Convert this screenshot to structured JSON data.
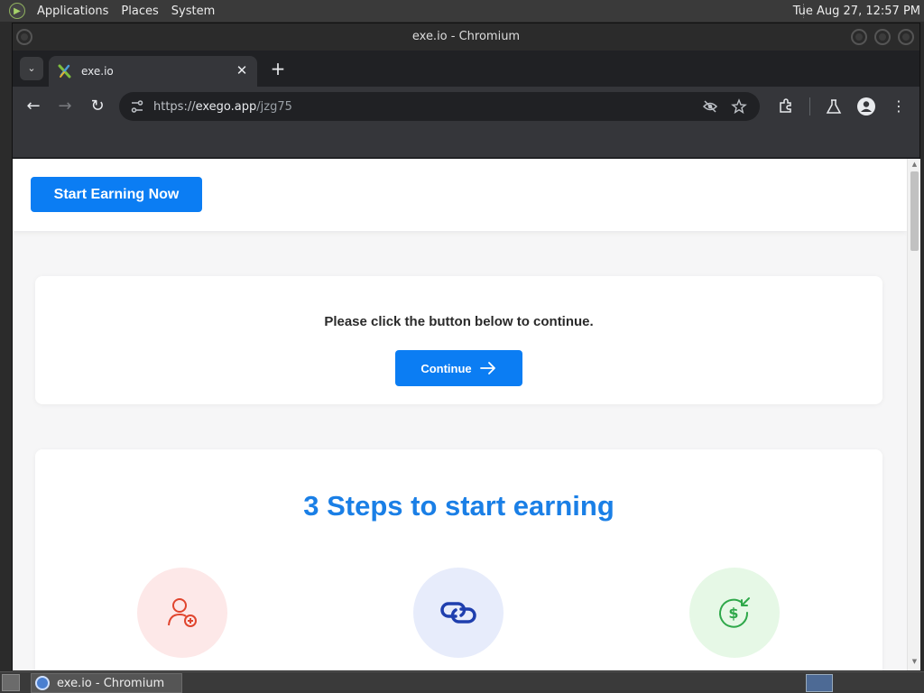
{
  "top_panel": {
    "menus": [
      "Applications",
      "Places",
      "System"
    ],
    "clock": "Tue Aug 27, 12:57 PM"
  },
  "window": {
    "title": "exe.io - Chromium"
  },
  "tabs": [
    {
      "label": "exe.io",
      "active": true
    }
  ],
  "omnibox": {
    "url_scheme": "https://",
    "url_host": "exego.app",
    "url_path": "/jzg75"
  },
  "page": {
    "header_button": "Start Earning Now",
    "continue_message": "Please click the button below to continue.",
    "continue_button": "Continue",
    "steps_title": "3 Steps to start earning",
    "steps": [
      {
        "icon": "user-add-icon",
        "color": "#e0452e",
        "bg": "#fde8e8"
      },
      {
        "icon": "link-icon",
        "color": "#1f3fae",
        "bg": "#e7ecfb"
      },
      {
        "icon": "dollar-exchange-icon",
        "color": "#2fa84a",
        "bg": "#e6f8e6"
      }
    ]
  },
  "taskbar": {
    "task_label": "exe.io - Chromium"
  },
  "colors": {
    "accent": "#0b7df3",
    "steps_title": "#1a7fe6"
  }
}
